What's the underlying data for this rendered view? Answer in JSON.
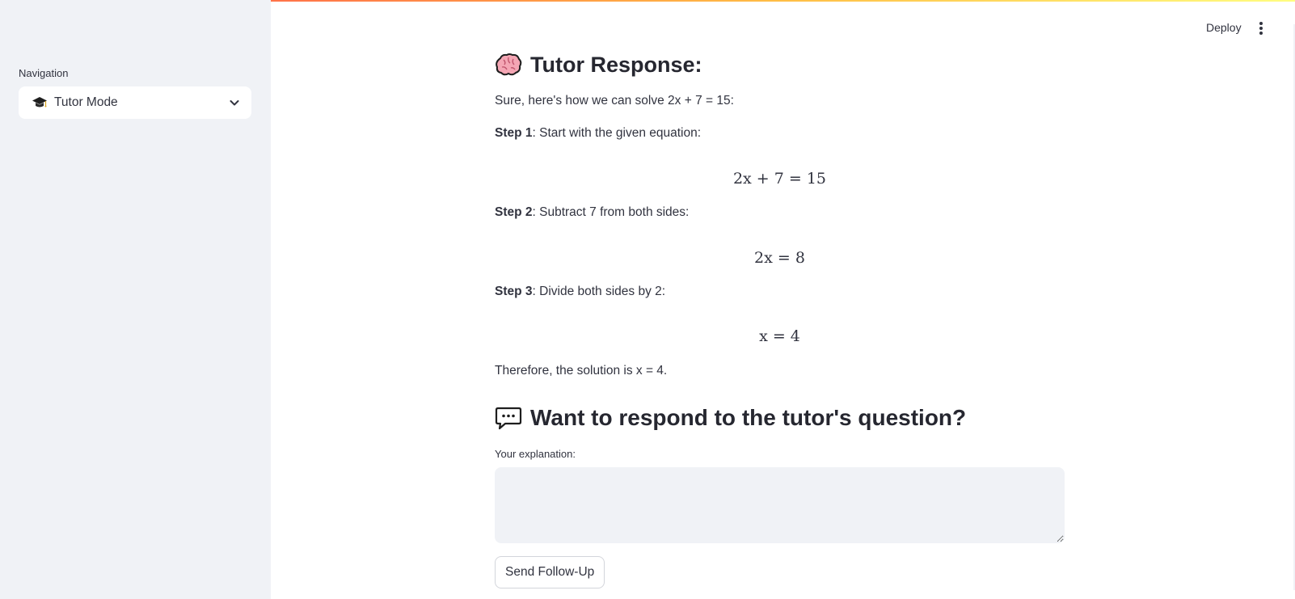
{
  "sidebar": {
    "nav_label": "Navigation",
    "select_value": "Tutor Mode",
    "select_icon": "graduation-cap-icon"
  },
  "header": {
    "deploy_label": "Deploy",
    "menu_icon": "kebab-menu-icon"
  },
  "response": {
    "title": "Tutor Response:",
    "title_icon": "brain-icon",
    "intro": "Sure, here's how we can solve 2x + 7 = 15:",
    "steps": [
      {
        "label": "Step 1",
        "text": ": Start with the given equation:",
        "equation": "2x + 7 = 15"
      },
      {
        "label": "Step 2",
        "text": ": Subtract 7 from both sides:",
        "equation": "2x = 8"
      },
      {
        "label": "Step 3",
        "text": ": Divide both sides by 2:",
        "equation": "x = 4"
      }
    ],
    "conclusion": "Therefore, the solution is x = 4."
  },
  "followup": {
    "title": "Want to respond to the tutor's question?",
    "title_icon": "speech-bubble-icon",
    "textarea_label": "Your explanation:",
    "textarea_value": "",
    "send_label": "Send Follow-Up"
  },
  "colors": {
    "sidebar_bg": "#f0f2f6",
    "text": "#31333f",
    "accent_red": "#ff4b4b"
  }
}
